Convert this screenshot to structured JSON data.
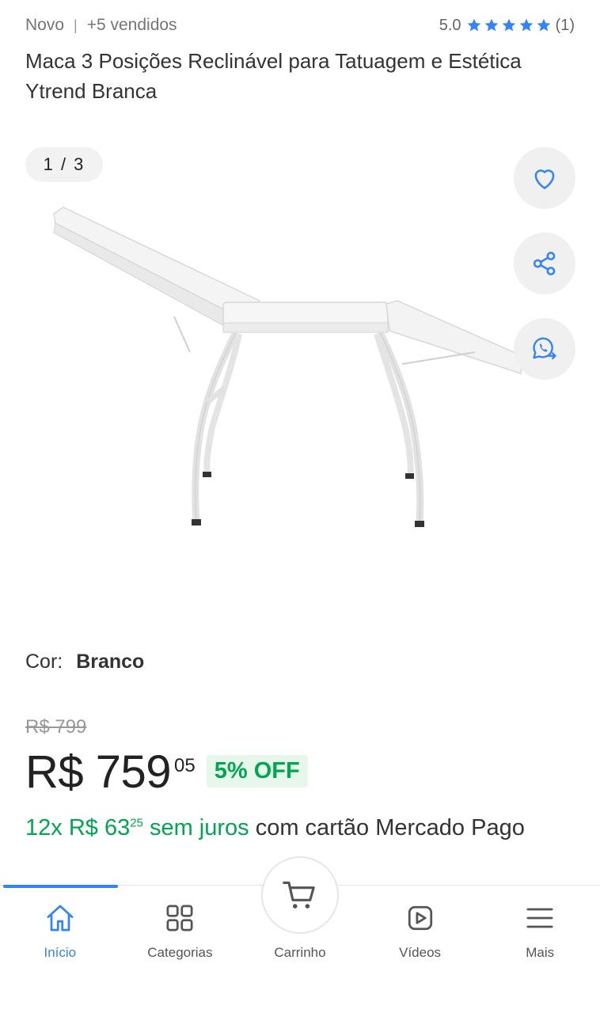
{
  "meta": {
    "condition": "Novo",
    "separator": "|",
    "sold": "+5 vendidos",
    "rating": "5.0",
    "review_count": "(1)",
    "star_color": "#3483fa"
  },
  "product": {
    "title": "Maca 3 Posições Reclinável para Tatuagem e Estética Ytrend Branca"
  },
  "gallery": {
    "counter": "1 / 3",
    "actions": [
      "heart-icon",
      "share-icon",
      "whatsapp-icon"
    ]
  },
  "variation": {
    "label": "Cor:",
    "value": "Branco"
  },
  "price": {
    "original": "R$ 799",
    "current": "R$ 759",
    "cents": "05",
    "discount": "5% OFF"
  },
  "installments": {
    "count_text": "12x R$ 63",
    "cents": "25",
    "interest": "sem juros",
    "rest": "com cartão Mercado Pago"
  },
  "nav": {
    "items": [
      {
        "label": "Início",
        "icon": "home-icon",
        "active": true
      },
      {
        "label": "Categorias",
        "icon": "grid-icon",
        "active": false
      },
      {
        "label": "Carrinho",
        "icon": "cart-icon",
        "active": false
      },
      {
        "label": "Vídeos",
        "icon": "video-icon",
        "active": false
      },
      {
        "label": "Mais",
        "icon": "menu-icon",
        "active": false
      }
    ]
  },
  "colors": {
    "accent": "#3483fa",
    "green": "#00a650"
  }
}
